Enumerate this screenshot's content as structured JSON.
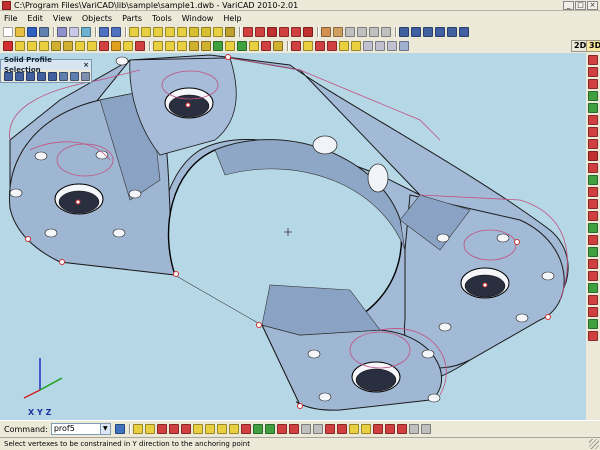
{
  "window": {
    "title": "C:\\Program Files\\VariCAD\\lib\\sample\\sample1.dwb - VariCAD 2010-2.01",
    "controls": [
      "_",
      "□",
      "×"
    ]
  },
  "menu": {
    "items": [
      "File",
      "Edit",
      "View",
      "Objects",
      "Parts",
      "Tools",
      "Window",
      "Help"
    ]
  },
  "toolbar": {
    "view_2d_label": "2D",
    "view_3d_label": "3D"
  },
  "panel": {
    "title": "Solid Profile Selection",
    "close": "×"
  },
  "viewport": {
    "background_color": "#b6d8e6",
    "part_color": "#9fb6d2",
    "axis_labels": {
      "x": "X",
      "y": "Y",
      "z": "Z"
    }
  },
  "command": {
    "label": "Command:",
    "value": "prof5"
  },
  "status": {
    "message": "Select vertexes to be constrained in Y direction to the anchoring point"
  },
  "colors": {
    "ui_background": "#ece9d8",
    "highlight_edge": "#c05080",
    "accent_red": "#d03030"
  }
}
